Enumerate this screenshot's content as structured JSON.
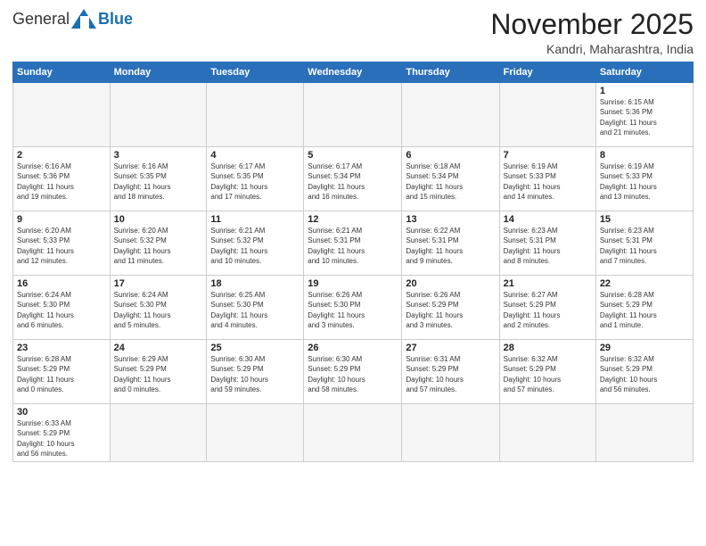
{
  "logo": {
    "general": "General",
    "blue": "Blue"
  },
  "title": "November 2025",
  "location": "Kandri, Maharashtra, India",
  "days_of_week": [
    "Sunday",
    "Monday",
    "Tuesday",
    "Wednesday",
    "Thursday",
    "Friday",
    "Saturday"
  ],
  "weeks": [
    [
      {
        "day": "",
        "info": ""
      },
      {
        "day": "",
        "info": ""
      },
      {
        "day": "",
        "info": ""
      },
      {
        "day": "",
        "info": ""
      },
      {
        "day": "",
        "info": ""
      },
      {
        "day": "",
        "info": ""
      },
      {
        "day": "1",
        "info": "Sunrise: 6:15 AM\nSunset: 5:36 PM\nDaylight: 11 hours\nand 21 minutes."
      }
    ],
    [
      {
        "day": "2",
        "info": "Sunrise: 6:16 AM\nSunset: 5:36 PM\nDaylight: 11 hours\nand 19 minutes."
      },
      {
        "day": "3",
        "info": "Sunrise: 6:16 AM\nSunset: 5:35 PM\nDaylight: 11 hours\nand 18 minutes."
      },
      {
        "day": "4",
        "info": "Sunrise: 6:17 AM\nSunset: 5:35 PM\nDaylight: 11 hours\nand 17 minutes."
      },
      {
        "day": "5",
        "info": "Sunrise: 6:17 AM\nSunset: 5:34 PM\nDaylight: 11 hours\nand 16 minutes."
      },
      {
        "day": "6",
        "info": "Sunrise: 6:18 AM\nSunset: 5:34 PM\nDaylight: 11 hours\nand 15 minutes."
      },
      {
        "day": "7",
        "info": "Sunrise: 6:19 AM\nSunset: 5:33 PM\nDaylight: 11 hours\nand 14 minutes."
      },
      {
        "day": "8",
        "info": "Sunrise: 6:19 AM\nSunset: 5:33 PM\nDaylight: 11 hours\nand 13 minutes."
      }
    ],
    [
      {
        "day": "9",
        "info": "Sunrise: 6:20 AM\nSunset: 5:33 PM\nDaylight: 11 hours\nand 12 minutes."
      },
      {
        "day": "10",
        "info": "Sunrise: 6:20 AM\nSunset: 5:32 PM\nDaylight: 11 hours\nand 11 minutes."
      },
      {
        "day": "11",
        "info": "Sunrise: 6:21 AM\nSunset: 5:32 PM\nDaylight: 11 hours\nand 10 minutes."
      },
      {
        "day": "12",
        "info": "Sunrise: 6:21 AM\nSunset: 5:31 PM\nDaylight: 11 hours\nand 10 minutes."
      },
      {
        "day": "13",
        "info": "Sunrise: 6:22 AM\nSunset: 5:31 PM\nDaylight: 11 hours\nand 9 minutes."
      },
      {
        "day": "14",
        "info": "Sunrise: 6:23 AM\nSunset: 5:31 PM\nDaylight: 11 hours\nand 8 minutes."
      },
      {
        "day": "15",
        "info": "Sunrise: 6:23 AM\nSunset: 5:31 PM\nDaylight: 11 hours\nand 7 minutes."
      }
    ],
    [
      {
        "day": "16",
        "info": "Sunrise: 6:24 AM\nSunset: 5:30 PM\nDaylight: 11 hours\nand 6 minutes."
      },
      {
        "day": "17",
        "info": "Sunrise: 6:24 AM\nSunset: 5:30 PM\nDaylight: 11 hours\nand 5 minutes."
      },
      {
        "day": "18",
        "info": "Sunrise: 6:25 AM\nSunset: 5:30 PM\nDaylight: 11 hours\nand 4 minutes."
      },
      {
        "day": "19",
        "info": "Sunrise: 6:26 AM\nSunset: 5:30 PM\nDaylight: 11 hours\nand 3 minutes."
      },
      {
        "day": "20",
        "info": "Sunrise: 6:26 AM\nSunset: 5:29 PM\nDaylight: 11 hours\nand 3 minutes."
      },
      {
        "day": "21",
        "info": "Sunrise: 6:27 AM\nSunset: 5:29 PM\nDaylight: 11 hours\nand 2 minutes."
      },
      {
        "day": "22",
        "info": "Sunrise: 6:28 AM\nSunset: 5:29 PM\nDaylight: 11 hours\nand 1 minute."
      }
    ],
    [
      {
        "day": "23",
        "info": "Sunrise: 6:28 AM\nSunset: 5:29 PM\nDaylight: 11 hours\nand 0 minutes."
      },
      {
        "day": "24",
        "info": "Sunrise: 6:29 AM\nSunset: 5:29 PM\nDaylight: 11 hours\nand 0 minutes."
      },
      {
        "day": "25",
        "info": "Sunrise: 6:30 AM\nSunset: 5:29 PM\nDaylight: 10 hours\nand 59 minutes."
      },
      {
        "day": "26",
        "info": "Sunrise: 6:30 AM\nSunset: 5:29 PM\nDaylight: 10 hours\nand 58 minutes."
      },
      {
        "day": "27",
        "info": "Sunrise: 6:31 AM\nSunset: 5:29 PM\nDaylight: 10 hours\nand 57 minutes."
      },
      {
        "day": "28",
        "info": "Sunrise: 6:32 AM\nSunset: 5:29 PM\nDaylight: 10 hours\nand 57 minutes."
      },
      {
        "day": "29",
        "info": "Sunrise: 6:32 AM\nSunset: 5:29 PM\nDaylight: 10 hours\nand 56 minutes."
      }
    ],
    [
      {
        "day": "30",
        "info": "Sunrise: 6:33 AM\nSunset: 5:29 PM\nDaylight: 10 hours\nand 56 minutes."
      },
      {
        "day": "",
        "info": ""
      },
      {
        "day": "",
        "info": ""
      },
      {
        "day": "",
        "info": ""
      },
      {
        "day": "",
        "info": ""
      },
      {
        "day": "",
        "info": ""
      },
      {
        "day": "",
        "info": ""
      }
    ]
  ]
}
